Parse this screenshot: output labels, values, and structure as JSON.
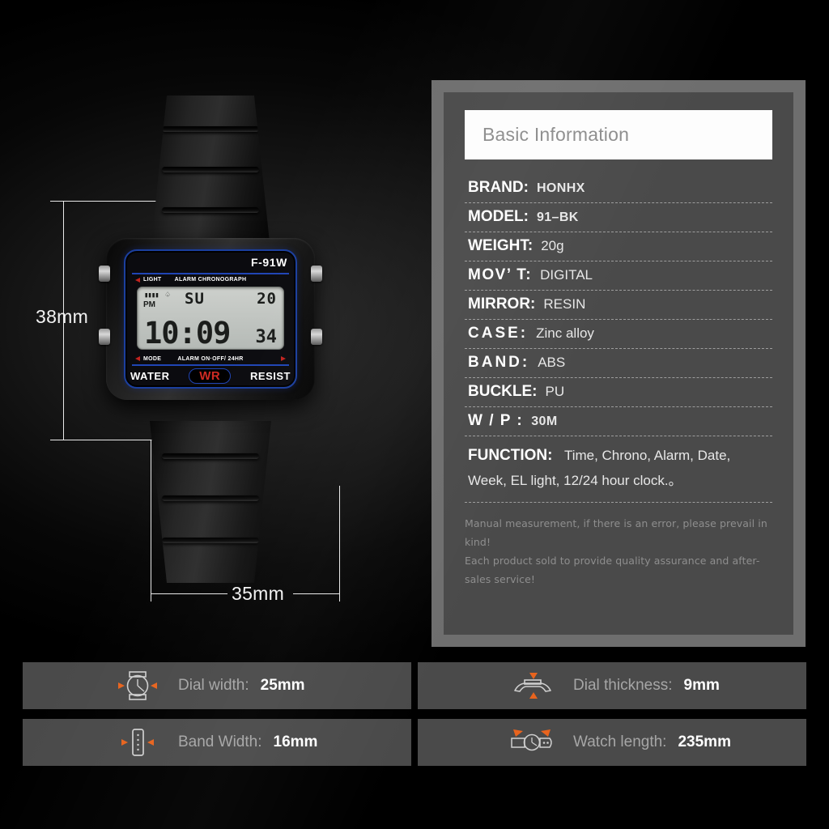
{
  "theme": {
    "background": "#000000",
    "panel_frame": "#6e6e6e",
    "panel_body": "#4a4a4a",
    "title_bg": "#fdfdfd",
    "title_text": "#8d8d8d",
    "accent_orange": "#e8641e",
    "accent_red": "#cf2a22",
    "accent_blue": "#2045b5",
    "label_gray": "#a6a6a6",
    "value_white": "#ffffff"
  },
  "product_photo": {
    "dimension_height": "38mm",
    "dimension_width": "35mm",
    "watch": {
      "model_print": "F-91W",
      "light_label": "LIGHT",
      "chrono_label": "ALARM CHRONOGRAPH",
      "mode_label": "MODE",
      "alarm_label": "ALARM ON·OFF/ 24HR",
      "water_left": "WATER",
      "water_badge": "WR",
      "water_right": "RESIST",
      "lcd": {
        "battery_icon": "battery-bars-icon",
        "alarm_icon": "bell-icon",
        "pm": "PM",
        "day": "SU",
        "date": "20",
        "time": "10:09",
        "seconds": "34"
      }
    }
  },
  "panel": {
    "title": "Basic Information",
    "specs": [
      {
        "key": "BRAND:",
        "value": "HONHX",
        "key_spacing": "normal",
        "value_bold": true
      },
      {
        "key": "MODEL:",
        "value": "91–BK",
        "key_spacing": "normal",
        "value_bold": true
      },
      {
        "key": "WEIGHT:",
        "value": "20g",
        "key_spacing": "normal",
        "value_bold": false
      },
      {
        "key": "MOV’ T:",
        "value": "DIGITAL",
        "key_spacing": "mid",
        "value_bold": false
      },
      {
        "key": "MIRROR:",
        "value": "RESIN",
        "key_spacing": "normal",
        "value_bold": false
      },
      {
        "key": "CASE:",
        "value": "Zinc alloy",
        "key_spacing": "wide",
        "value_bold": false
      },
      {
        "key": "BAND:",
        "value": "ABS",
        "key_spacing": "wide",
        "value_bold": false
      },
      {
        "key": "BUCKLE:",
        "value": "PU",
        "key_spacing": "normal",
        "value_bold": false
      },
      {
        "key": "W / P :",
        "value": "30M",
        "key_spacing": "mid",
        "value_bold": true
      }
    ],
    "function": {
      "key": "FUNCTION:",
      "value": "Time, Chrono,  Alarm,  Date,  Week,  EL light,  12/24 hour clock.。"
    },
    "disclaimer": [
      "Manual measurement, if there is an error, please prevail in kind!",
      "Each product sold to provide quality assurance and after-sales service!"
    ]
  },
  "bars": [
    {
      "icon": "watch-dial-icon",
      "label": "Dial width:",
      "value": "25mm"
    },
    {
      "icon": "watch-profile-icon",
      "label": "Dial thickness:",
      "value": "9mm"
    },
    {
      "icon": "watch-band-icon",
      "label": "Band Width:",
      "value": "16mm"
    },
    {
      "icon": "watch-length-icon",
      "label": "Watch length:",
      "value": "235mm"
    }
  ]
}
